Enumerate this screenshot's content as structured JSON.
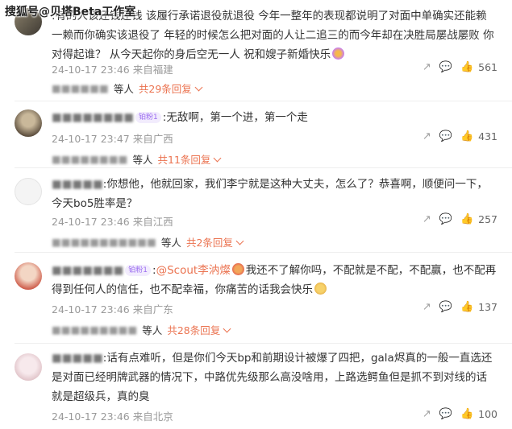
{
  "watermark": "搜狐号@贝塔Beta工作室",
  "comments": [
    {
      "name": "",
      "badge": "",
      "mention": "",
      "text": ":有的人该还钱还钱 该履行承诺退役就退役 今年一整年的表现都说明了对面中单确实还能赖一赖而你确实该退役了 年轻的时候怎么把对面的人让二追三的而今年却在决胜局屡战屡败 你对得起谁？ 从今天起你的身后空无一人 祝和嫂子新婚快乐",
      "time": "24-10-17 23:46 来自福建",
      "likes": "561",
      "reply_name": "",
      "reply_others": "等人",
      "reply_link": "共29条回复"
    },
    {
      "name": "",
      "badge": "铂粉1",
      "mention": "",
      "text": ":无敌啊，第一个进，第一个走",
      "time": "24-10-17 23:47 来自广西",
      "likes": "431",
      "reply_name": "",
      "reply_others": "等人",
      "reply_link": "共11条回复"
    },
    {
      "name": "",
      "badge": "",
      "mention": "",
      "text": ":你想他，他就回家，我们李宁就是这种大丈夫，怎么了？恭喜啊，顺便问一下，今天bo5胜率是？",
      "time": "24-10-17 23:46 来自江西",
      "likes": "257",
      "reply_name": "",
      "reply_others": "等人",
      "reply_link": "共2条回复"
    },
    {
      "name": "",
      "badge": "铂粉1",
      "mention": "@Scout李汭燦",
      "text": "我还不了解你吗，不配就是不配，不配赢，也不配再得到任何人的信任，也不配幸福，你痛苦的话我会快乐",
      "time": "24-10-17 23:46 来自广东",
      "likes": "137",
      "reply_name": "",
      "reply_others": "等人",
      "reply_link": "共28条回复"
    },
    {
      "name": "",
      "badge": "",
      "mention": "",
      "text": ":话有点难听，但是你们今天bp和前期设计被爆了四把，gala烬真的一般一直选还是对面已经明牌武器的情况下，中路优先级那么高没啥用，上路选鳄鱼但是抓不到对线的话就是超级兵，真的臭",
      "time": "24-10-17 23:46 来自北京",
      "likes": "100",
      "reply_name": "",
      "reply_others": "",
      "reply_link": ""
    }
  ],
  "icons": {
    "share": "share-icon",
    "comment": "comment-icon",
    "like": "thumbs-up-icon"
  },
  "colors": {
    "link": "#eb7350",
    "meta": "#999999",
    "badge": "#9b6cf0"
  }
}
